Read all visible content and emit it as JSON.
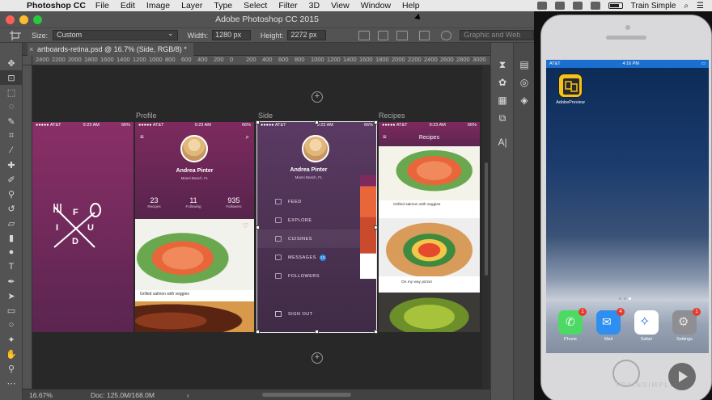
{
  "menubar": {
    "app_name": "Photoshop CC",
    "items": [
      "File",
      "Edit",
      "Image",
      "Layer",
      "Type",
      "Select",
      "Filter",
      "3D",
      "View",
      "Window",
      "Help"
    ],
    "user": "Train Simple"
  },
  "window": {
    "title": "Adobe Photoshop CC 2015"
  },
  "options": {
    "size_label": "Size:",
    "size_value": "Custom",
    "width_label": "Width:",
    "width_value": "1280 px",
    "height_label": "Height:",
    "height_value": "2272 px",
    "workspace_placeholder": "Graphic and Web"
  },
  "document": {
    "tab_title": "artboards-retina.psd @ 16.7% (Side, RGB/8) *",
    "zoom": "16.67%",
    "doc_info": "Doc: 125.0M/168.0M"
  },
  "ruler": {
    "ticks": [
      "2400",
      "2200",
      "2000",
      "1800",
      "1600",
      "1400",
      "1200",
      "1000",
      "800",
      "600",
      "400",
      "200",
      "0",
      "200",
      "400",
      "600",
      "800",
      "1000",
      "1200",
      "1400",
      "1600",
      "1800",
      "2000",
      "2200",
      "2400",
      "2600",
      "2800",
      "3000"
    ]
  },
  "artboards": {
    "profile_label": "Profile",
    "side_label": "Side",
    "recipes_label": "Recipes",
    "status_carrier": "●●●●● AT&T",
    "status_time": "9:23 AM",
    "status_battery": "66%",
    "fud_letters": {
      "f": "F",
      "i": "I",
      "u": "U",
      "d": "D"
    },
    "profile": {
      "name": "Andrea Pinter",
      "location": "Miami Beach, FL",
      "stats": [
        {
          "num": "23",
          "label": "Recipes"
        },
        {
          "num": "11",
          "label": "Following"
        },
        {
          "num": "935",
          "label": "Followers"
        }
      ],
      "caption": "Grilled salmon with veggies"
    },
    "side": {
      "name": "Andrea Pinter",
      "location": "Miami Beach, FL",
      "menu": [
        "FEED",
        "EXPLORE",
        "CUISINES",
        "MESSAGES",
        "FOLLOWERS"
      ],
      "messages_badge": "10",
      "sign_out": "SIGN OUT"
    },
    "recipes": {
      "title": "Recipes",
      "caption1": "Grilled salmon with veggies",
      "caption2": "On my way pizza!"
    }
  },
  "phone": {
    "carrier": "AT&T",
    "time": "4:16 PM",
    "app_label": "AdobePreview",
    "dock": [
      {
        "label": "Phone",
        "badge": "1"
      },
      {
        "label": "Mail",
        "badge": "4"
      },
      {
        "label": "Safari",
        "badge": ""
      },
      {
        "label": "Settings",
        "badge": "1"
      }
    ],
    "brand": "TRAINSIMPLE"
  }
}
